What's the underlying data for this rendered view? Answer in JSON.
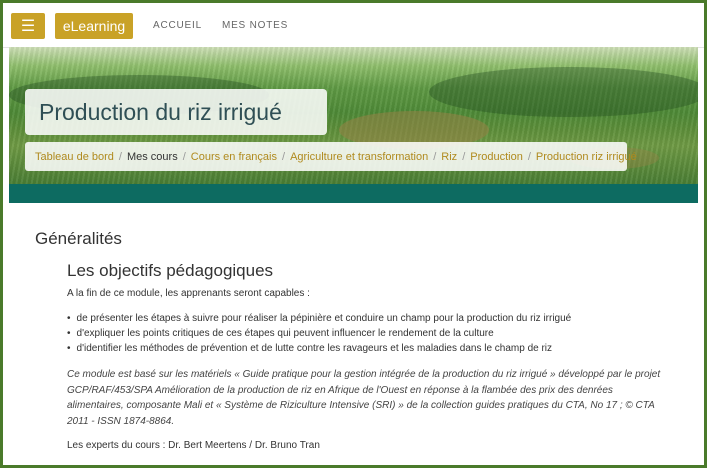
{
  "header": {
    "menu_icon": "hamburger-icon",
    "brand": "eLearning",
    "nav": [
      "ACCUEIL",
      "MES NOTES"
    ]
  },
  "hero": {
    "title": "Production du riz irrigué"
  },
  "breadcrumb": [
    {
      "label": "Tableau de bord",
      "link": true
    },
    {
      "label": "Mes cours",
      "link": false
    },
    {
      "label": "Cours en français",
      "link": true
    },
    {
      "label": "Agriculture et transformation",
      "link": true
    },
    {
      "label": "Riz",
      "link": true
    },
    {
      "label": "Production",
      "link": true
    },
    {
      "label": "Production riz irrigué",
      "link": true
    }
  ],
  "colors": {
    "accent": "#c9a227",
    "teal_bar": "#0d6b61",
    "frame": "#4a7a2a"
  },
  "content": {
    "section_title": "Généralités",
    "subheading": "Les objectifs pédagogiques",
    "intro": "A la fin de ce module, les apprenants seront capables :",
    "bullets": [
      "de présenter les étapes à suivre pour réaliser la pépinière et conduire un champ pour la production du riz irrigué",
      "d'expliquer les points critiques de ces étapes qui peuvent influencer le rendement de la culture",
      "d'identifier les méthodes de prévention et de lutte contre les ravageurs et les maladies dans le champ de riz"
    ],
    "reference_lines": [
      "Ce module est basé sur les matériels « Guide pratique pour la gestion intégrée de la production du riz irrigué » développé par le projet",
      "GCP/RAF/453/SPA Amélioration de la production de riz en Afrique de l'Ouest en réponse à la flambée des prix des  denrées",
      "alimentaires, composante Mali et « Système de Riziculture Intensive (SRI) » de la collection guides pratiques du CTA, No 17 ; © CTA",
      "2011 - ISSN 1874-8864."
    ],
    "experts": "Les experts du cours : Dr. Bert Meertens / Dr. Bruno Tran"
  }
}
